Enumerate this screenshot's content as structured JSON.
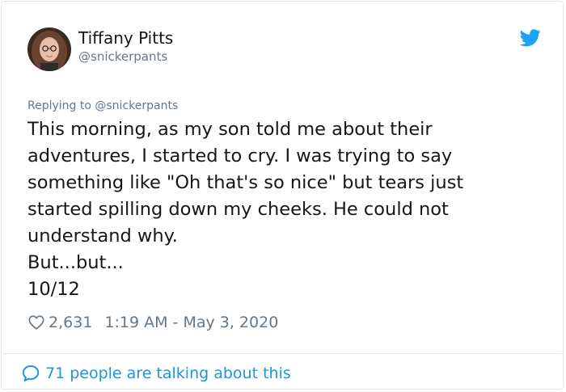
{
  "author": {
    "display_name": "Tiffany Pitts",
    "handle": "@snickerpants"
  },
  "reply": {
    "prefix": "Replying to ",
    "handle": "@snickerpants"
  },
  "tweet": {
    "lines": [
      "This morning, as my son told me about their",
      "adventures, I started to cry. I was trying to say",
      "something like \"Oh that's so nice\" but tears just",
      "started spilling down my cheeks. He could not",
      "understand why.",
      "But...but...",
      "10/12"
    ]
  },
  "meta": {
    "like_count": "2,631",
    "timestamp": "1:19 AM - May 3, 2020"
  },
  "footer": {
    "talking_text": "71 people are talking about this"
  },
  "icons": {
    "brand": "twitter-bird-icon",
    "like": "heart-icon",
    "conversation": "speech-bubble-icon"
  },
  "colors": {
    "brand_blue": "#1da1f2",
    "link_blue": "#1b95e0",
    "text": "#14171a",
    "muted": "#657786"
  }
}
